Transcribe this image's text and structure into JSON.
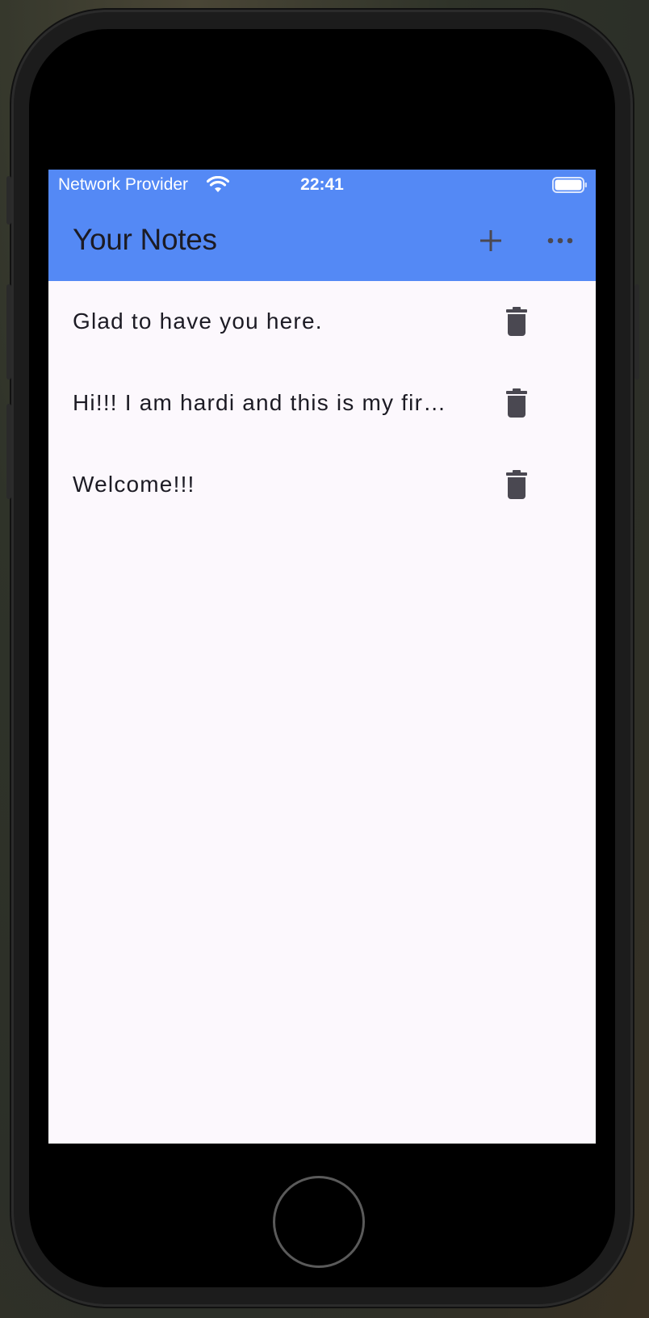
{
  "status_bar": {
    "carrier": "Network Provider",
    "time": "22:41",
    "wifi_icon": "wifi-icon",
    "battery_icon": "battery-icon"
  },
  "app_bar": {
    "title": "Your Notes",
    "add_icon": "plus-icon",
    "more_icon": "more-horizontal-icon",
    "background_color": "#5489f5"
  },
  "notes": [
    {
      "text": "Glad to have you here.",
      "delete_icon": "trash-icon"
    },
    {
      "text": "Hi!!! I am hardi and this is my fir…",
      "delete_icon": "trash-icon"
    },
    {
      "text": "Welcome!!!",
      "delete_icon": "trash-icon"
    }
  ],
  "colors": {
    "accent": "#5489f5",
    "background": "#fcf8fd",
    "text": "#1c1b24",
    "icon": "#4a4851"
  }
}
